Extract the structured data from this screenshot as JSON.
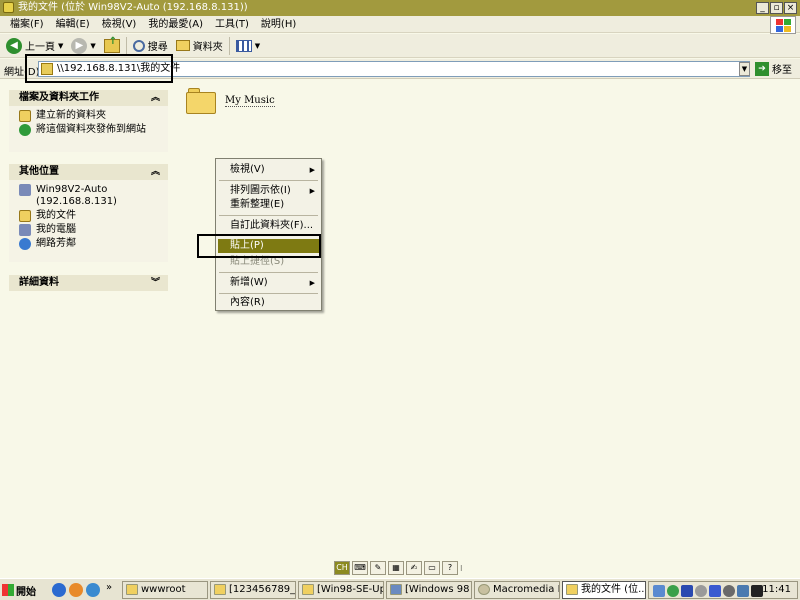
{
  "window": {
    "title": "我的文件 (位於 Win98V2-Auto (192.168.8.131))",
    "controls": [
      "_",
      "▫",
      "×"
    ]
  },
  "menu": [
    "檔案(F)",
    "編輯(E)",
    "檢視(V)",
    "我的最愛(A)",
    "工具(T)",
    "說明(H)"
  ],
  "toolbar": {
    "back_label": "上一頁",
    "search_label": "搜尋",
    "folders_label": "資料夾"
  },
  "address": {
    "label": "網址(D)",
    "value": "\\\\192.168.8.131\\我的文件",
    "go_label": "移至"
  },
  "panels": [
    {
      "title": "檔案及資料夾工作",
      "items": [
        "建立新的資料夾",
        "將這個資料夾發佈到網站"
      ]
    },
    {
      "title": "其他位置",
      "items": [
        "Win98V2-Auto (192.168.8.131)",
        "我的文件",
        "我的電腦",
        "網路芳鄰"
      ]
    },
    {
      "title": "詳細資料",
      "items": []
    }
  ],
  "content": {
    "folder_label": "My Music"
  },
  "context_menu": {
    "items": [
      "檢視(V)",
      "排列圖示依(I)",
      "重新整理(E)",
      "自訂此資料夾(F)...",
      "貼上(P)",
      "貼上捷徑(S)",
      "新增(W)",
      "內容(R)"
    ]
  },
  "langbar": {
    "ch_label": "CH",
    "help_label": "?"
  },
  "taskbar": {
    "start_label": "開始",
    "tasks": [
      "wwwroot",
      "[123456789_U...",
      "[Win98-SE-Up...",
      "[Windows 98 ...",
      "Macromedia Fi...",
      "我的文件 (位..."
    ],
    "clock": "11:41"
  }
}
